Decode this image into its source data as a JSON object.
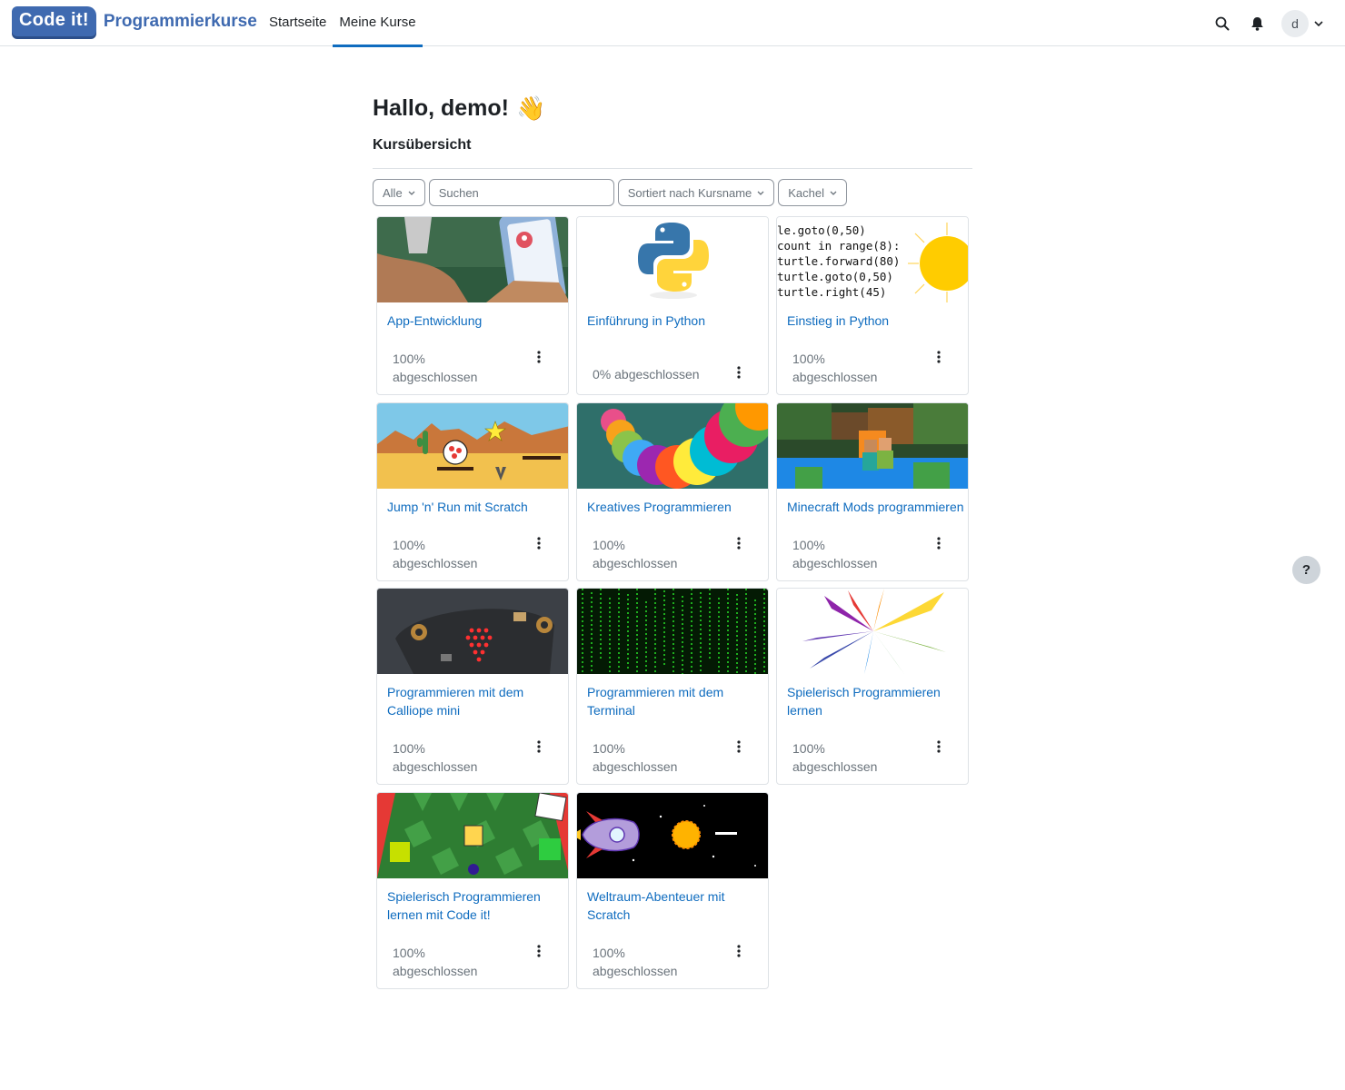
{
  "brand": {
    "badge": "Code it!",
    "name": "Programmierkurse"
  },
  "nav": {
    "links": [
      {
        "label": "Startseite"
      },
      {
        "label": "Meine Kurse",
        "active": true
      }
    ]
  },
  "header_icons": [
    "search-icon",
    "bell-icon"
  ],
  "user": {
    "initial": "d"
  },
  "main": {
    "greeting": "Hallo, demo!",
    "greeting_emoji": "👋",
    "section_title": "Kursübersicht"
  },
  "filters": {
    "grouping": "Alle",
    "search_placeholder": "Suchen",
    "sort": "Sortiert nach Kursname",
    "view": "Kachel"
  },
  "courses": [
    {
      "title": "App-Entwicklung",
      "progress": "100% abgeschlossen",
      "thumb": "app"
    },
    {
      "title": "Einführung in Python",
      "progress": "0% abgeschlossen",
      "thumb": "python-logo"
    },
    {
      "title": "Einstieg in Python",
      "progress": "100% abgeschlossen",
      "thumb": "turtle-code",
      "code_lines": [
        "le.goto(0,50)",
        "count in range(8):",
        "turtle.forward(80)",
        "turtle.goto(0,50)",
        "turtle.right(45)"
      ]
    },
    {
      "title": "Jump 'n' Run mit Scratch",
      "progress": "100% abgeschlossen",
      "thumb": "desert"
    },
    {
      "title": "Kreatives Programmieren",
      "progress": "100% abgeschlossen",
      "thumb": "spiral"
    },
    {
      "title": "Minecraft Mods programmieren",
      "progress": "100% abgeschlossen",
      "thumb": "minecraft"
    },
    {
      "title": "Programmieren mit dem Calliope mini",
      "progress": "100% abgeschlossen",
      "thumb": "calliope"
    },
    {
      "title": "Programmieren mit dem Terminal",
      "progress": "100% abgeschlossen",
      "thumb": "matrix"
    },
    {
      "title": "Spielerisch Programmieren lernen",
      "progress": "100% abgeschlossen",
      "thumb": "ribbons"
    },
    {
      "title": "Spielerisch Programmieren lernen mit Code it!",
      "progress": "100% abgeschlossen",
      "thumb": "checker"
    },
    {
      "title": "Weltraum-Abenteuer mit Scratch",
      "progress": "100% abgeschlossen",
      "thumb": "space"
    }
  ],
  "help": {
    "label": "?"
  },
  "colors": {
    "brand": "#3f6ab0",
    "link": "#0f6cbf",
    "muted": "#6a737b"
  }
}
